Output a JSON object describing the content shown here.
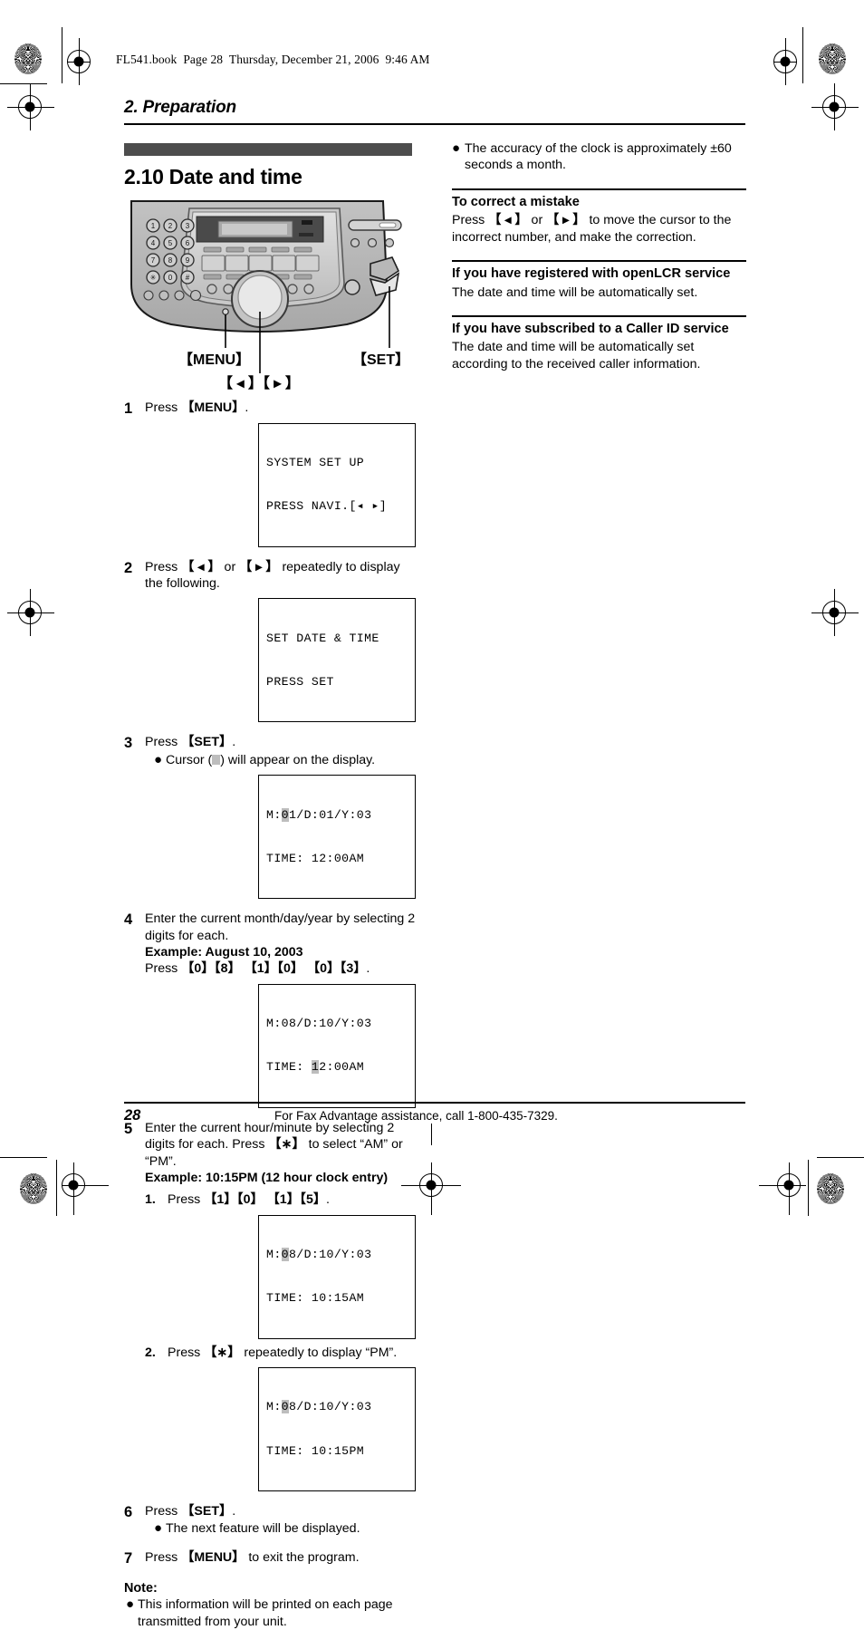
{
  "print_marks": {
    "book_line": "FL541.book  Page 28  Thursday, December 21, 2006  9:46 AM"
  },
  "chapter": {
    "title": "2. Preparation"
  },
  "section": {
    "number_title": "2.10 Date and time"
  },
  "illustration": {
    "keypad": [
      "1",
      "2",
      "3",
      "4",
      "5",
      "6",
      "7",
      "8",
      "9",
      "∗",
      "0",
      "#"
    ],
    "callouts": {
      "menu": "【MENU】",
      "set": "【SET】",
      "navigation": "【 ◂ 】【 ▸ 】"
    }
  },
  "steps": [
    {
      "num": "1",
      "text_html": "Press <b>【MENU】</b>.",
      "bullets": [],
      "lcd": [
        {
          "line1": "SYSTEM SET UP",
          "line2": "PRESS NAVI.[◂ ▸]"
        }
      ]
    },
    {
      "num": "2",
      "text_html": "Press <b>【 ◂ 】</b> or <b>【 ▸ 】</b> repeatedly to display the following.",
      "bullets": [],
      "lcd": [
        {
          "line1": "SET DATE & TIME",
          "line2": "PRESS SET"
        }
      ]
    },
    {
      "num": "3",
      "text_html": "Press <b>【SET】</b>.",
      "bullets": [
        "Cursor (■) will appear on the display."
      ],
      "lcd": [
        {
          "line1": "M:01/D:01/Y:03",
          "line2": "TIME: 12:00AM",
          "cursor_line": 1,
          "cursor_index": 2
        }
      ]
    },
    {
      "num": "4",
      "text_html": "Enter the current month/day/year by selecting 2 digits for each.<br><b>Example: August 10, 2003</b><br>Press <b>【0】【8】 【1】【0】 【0】【3】</b>.",
      "bullets": [],
      "lcd": [
        {
          "line1": "M:08/D:10/Y:03",
          "line2": "TIME: 12:00AM",
          "cursor_line": 2,
          "cursor_index": 6
        }
      ]
    },
    {
      "num": "5",
      "text_html": "Enter the current hour/minute by selecting 2 digits for each. Press <b>【∗】</b> to select “AM” or “PM”.<br><b>Example: 10:15PM (12 hour clock entry)</b>",
      "substeps": [
        {
          "num": "1.",
          "text_html": "Press <b>【1】【0】 【1】【5】</b>.",
          "lcd": {
            "line1": "M:08/D:10/Y:03",
            "line2": "TIME: 10:15AM",
            "cursor_line": 1,
            "cursor_index": 2
          }
        },
        {
          "num": "2.",
          "text_html": "Press <b>【∗】</b> repeatedly to display “PM”.",
          "lcd": {
            "line1": "M:08/D:10/Y:03",
            "line2": "TIME: 10:15PM",
            "cursor_line": 1,
            "cursor_index": 2
          }
        }
      ],
      "bullets": [],
      "lcd": []
    },
    {
      "num": "6",
      "text_html": "Press <b>【SET】</b>.",
      "bullets": [
        "The next feature will be displayed."
      ],
      "lcd": []
    },
    {
      "num": "7",
      "text_html": "Press <b>【MENU】</b> to exit the program.",
      "bullets": [],
      "lcd": []
    }
  ],
  "note": {
    "heading": "Note:",
    "bullets": [
      "This information will be printed on each page transmitted from your unit."
    ]
  },
  "right_column": {
    "top_bullet": "The accuracy of the clock is approximately ±60 seconds a month.",
    "blocks": [
      {
        "heading": "To correct a mistake",
        "body_html": "Press <b>【 ◂ 】</b> or <b>【 ▸ 】</b> to move the cursor to the incorrect number, and make the correction."
      },
      {
        "heading": "If you have registered with openLCR service",
        "body_html": "The date and time will be automatically set."
      },
      {
        "heading": "If you have subscribed to a Caller ID service",
        "body_html": "The date and time will be automatically set according to the received caller information."
      }
    ]
  },
  "footer": {
    "page_number": "28",
    "text": "For Fax Advantage assistance, call 1-800-435-7329."
  },
  "colors": {
    "section_bar": "#4d4d4d",
    "lcd_cursor": "#bdbdbd",
    "device_body": "#b4b4b4",
    "device_panel": "#cfcfcf"
  }
}
